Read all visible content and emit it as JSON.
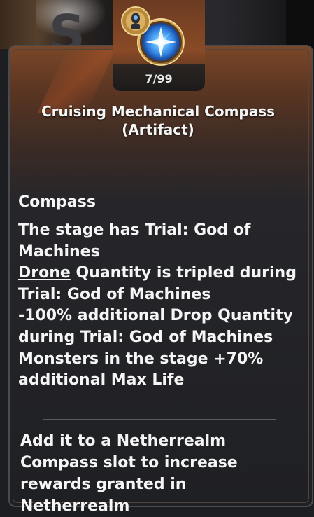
{
  "item": {
    "count": "7/99",
    "name": "Cruising Mechanical Compass",
    "category": "(Artifact)"
  },
  "section_title": "Compass",
  "effects": {
    "line1": "The stage has Trial: God of Machines",
    "drone_keyword": "Drone",
    "line2_rest": " Quantity is tripled during Trial: God of Machines",
    "line3": "-100% additional Drop Quantity during Trial: God of Machines",
    "line4": "Monsters in the stage +70% additional Max Life"
  },
  "usage": "Add it to a Netherrealm Compass slot to increase rewards granted in Netherrealm",
  "colors": {
    "panel_bg": "#1f2023",
    "header_glow": "#7a4728",
    "text": "#f5f5f5",
    "compass_gem": "#2f7fe0",
    "compass_ring": "#c99a45"
  },
  "icons": {
    "item_icon": "mechanical-compass-icon",
    "badge": "gold-relic-badge-icon"
  }
}
